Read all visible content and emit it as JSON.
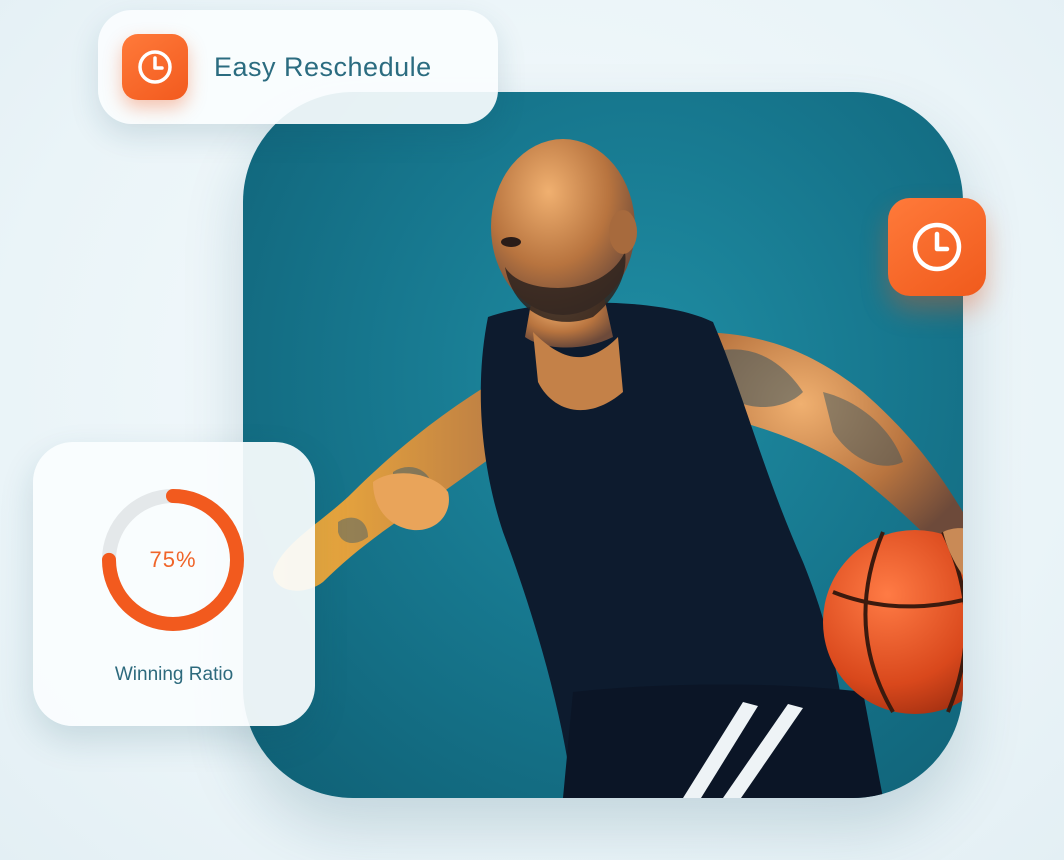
{
  "colors": {
    "accent_orange": "#f25a1e",
    "panel_teal": "#17788f",
    "label_teal": "#2b6c80",
    "ring_track": "#e4e8ea"
  },
  "reschedule_card": {
    "label": "Easy Reschedule",
    "icon": "clock-icon"
  },
  "floating_tile": {
    "icon": "clock-icon"
  },
  "stats_card": {
    "value_text": "75%",
    "progress": 0.75,
    "label": "Winning Ratio"
  }
}
